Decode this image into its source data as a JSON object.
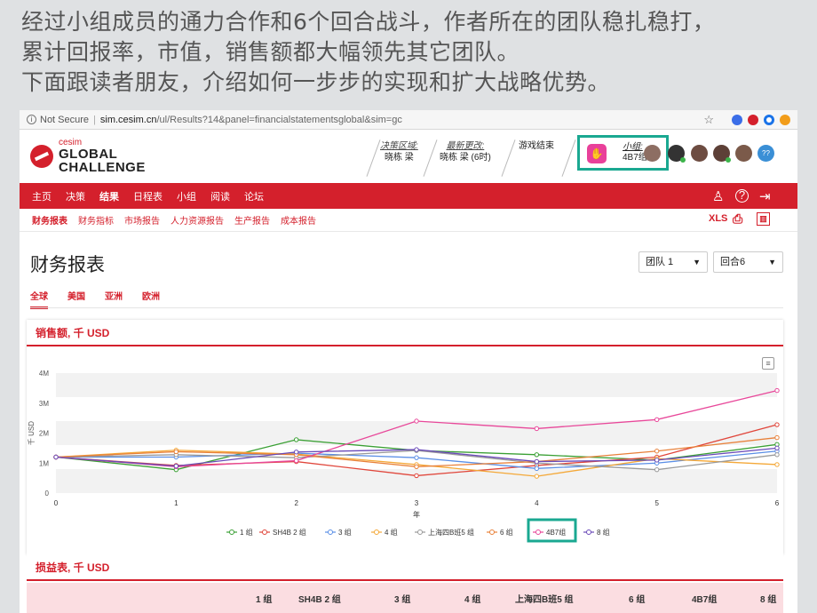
{
  "caption": {
    "line1": "经过小组成员的通力合作和6个回合战斗，作者所在的团队稳扎稳打，",
    "line2": "累计回报率，市值，销售额都大幅领先其它团队。",
    "line3": "下面跟读者朋友，介绍如何一步步的实现和扩大战略优势。"
  },
  "browser": {
    "security": "Not Secure",
    "host": "sim.cesim.cn",
    "path": "/ul/Results?14&panel=financialstatementsglobal&sim=gc"
  },
  "app": {
    "logo_small": "cesim",
    "logo_line1": "GLOBAL",
    "logo_line2": "CHALLENGE",
    "decision_area_label": "决策区域:",
    "decision_area_value": "晓栋 梁",
    "latest_update_label": "最新更改:",
    "latest_update_value": "晓栋 梁 (6时)",
    "game_status": "游戏结束",
    "team_label": "小组:",
    "team_value": "4B7组",
    "extra_badge": "??"
  },
  "nav": {
    "items": [
      "主页",
      "决策",
      "结果",
      "日程表",
      "小组",
      "阅读",
      "论坛"
    ],
    "active": "结果"
  },
  "subnav": {
    "items": [
      "财务报表",
      "财务指标",
      "市场报告",
      "人力资源报告",
      "生产报告",
      "成本报告"
    ],
    "xls": "XLS"
  },
  "page": {
    "title": "财务报表",
    "team_select": "团队 1",
    "round_select": "回合6",
    "regions": [
      "全球",
      "美国",
      "亚洲",
      "欧洲"
    ]
  },
  "card": {
    "title": "销售额, 千 USD",
    "table_title": "损益表, 千 USD"
  },
  "chart_data": {
    "type": "line",
    "title": "销售额, 千 USD",
    "xlabel": "年",
    "ylabel": "千 USD",
    "x": [
      0,
      1,
      2,
      3,
      4,
      5,
      6
    ],
    "ylim": [
      0,
      4000000
    ],
    "yticks": [
      "0",
      "1M",
      "2M",
      "3M",
      "4M"
    ],
    "series": [
      {
        "name": "1 组",
        "color": "#3ba035",
        "values": [
          1200000,
          780000,
          1780000,
          1420000,
          1280000,
          1100000,
          1620000
        ]
      },
      {
        "name": "SH4B 2 组",
        "color": "#e0463b",
        "values": [
          1200000,
          920000,
          1050000,
          580000,
          920000,
          1200000,
          2280000
        ]
      },
      {
        "name": "3 组",
        "color": "#5b8fe6",
        "values": [
          1200000,
          1200000,
          1330000,
          1180000,
          820000,
          1000000,
          1400000
        ]
      },
      {
        "name": "4 组",
        "color": "#f4a838",
        "values": [
          1200000,
          1430000,
          1300000,
          950000,
          560000,
          1150000,
          950000
        ]
      },
      {
        "name": "上海四B班5 组",
        "color": "#9a9a9a",
        "values": [
          1200000,
          1280000,
          1180000,
          1420000,
          1000000,
          780000,
          1280000
        ]
      },
      {
        "name": "6 组",
        "color": "#e8813a",
        "values": [
          1200000,
          1380000,
          1280000,
          880000,
          1050000,
          1400000,
          1850000
        ]
      },
      {
        "name": "4B7组",
        "color": "#e8489a",
        "values": [
          1200000,
          880000,
          1080000,
          2400000,
          2150000,
          2450000,
          3420000
        ]
      },
      {
        "name": "8 组",
        "color": "#6a4ab8",
        "values": [
          1200000,
          900000,
          1370000,
          1450000,
          1050000,
          1100000,
          1500000
        ]
      }
    ]
  },
  "table": {
    "columns": [
      "1 组",
      "SH4B 2 组",
      "3 组",
      "4 组",
      "上海四B班5 组",
      "6 组",
      "4B7组",
      "8 组"
    ]
  }
}
